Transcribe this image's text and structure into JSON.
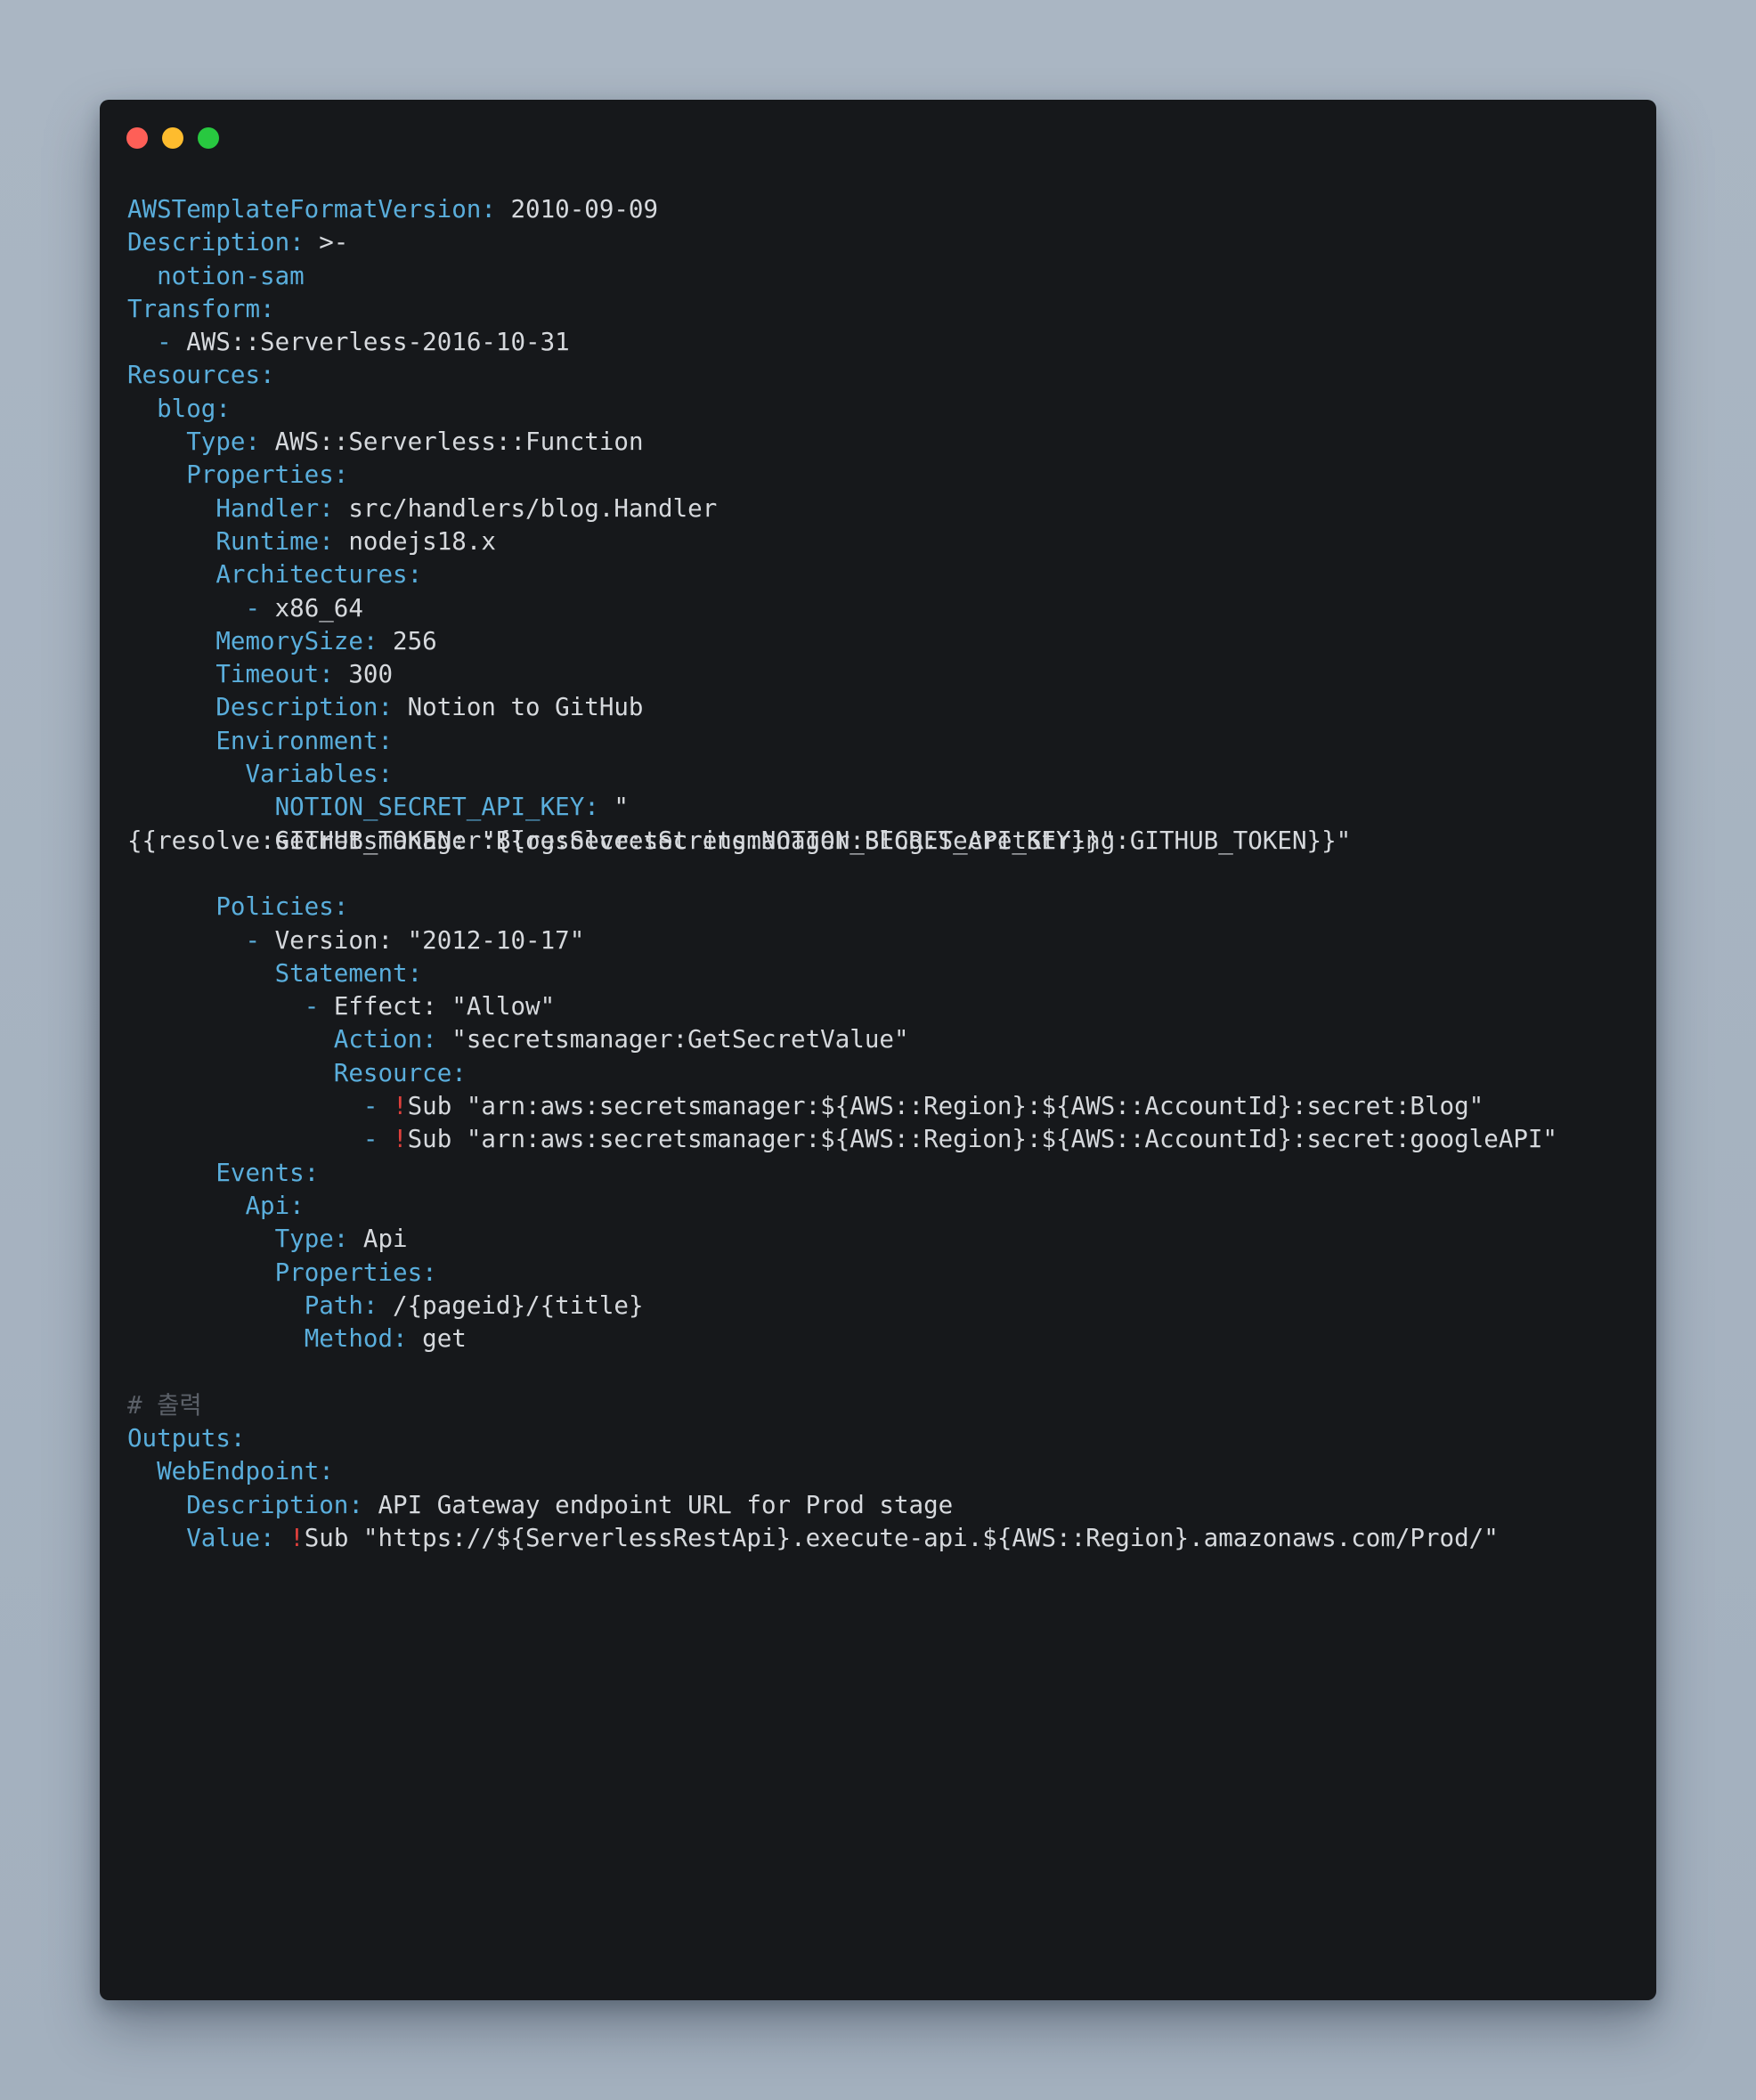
{
  "window": {
    "buttons": {
      "close_color": "#fe5f57",
      "minimize_color": "#febc2e",
      "maximize_color": "#28c840"
    }
  },
  "code": {
    "language": "yaml",
    "colors": {
      "key": "#5aaedc",
      "value": "#d6d9dd",
      "tag": "#e0403c",
      "comment": "#5b6068",
      "background": "#16181b"
    },
    "lines": [
      {
        "indent": "",
        "key": "AWSTemplateFormatVersion:",
        "value": " 2010-09-09"
      },
      {
        "indent": "",
        "key": "Description:",
        "value": " >-"
      },
      {
        "indent": "  ",
        "key": "",
        "key_value": "notion-sam"
      },
      {
        "indent": "",
        "key": "Transform:"
      },
      {
        "indent": "  ",
        "dash": "- ",
        "value": "AWS::Serverless-2016-10-31"
      },
      {
        "indent": "",
        "key": "Resources:"
      },
      {
        "indent": "  ",
        "key": "blog:"
      },
      {
        "indent": "    ",
        "key": "Type:",
        "value": " AWS::Serverless::Function"
      },
      {
        "indent": "    ",
        "key": "Properties:"
      },
      {
        "indent": "      ",
        "key": "Handler:",
        "value": " src/handlers/blog.Handler"
      },
      {
        "indent": "      ",
        "key": "Runtime:",
        "value": " nodejs18.x"
      },
      {
        "indent": "      ",
        "key": "Architectures:"
      },
      {
        "indent": "        ",
        "dash": "- ",
        "value": "x86_64"
      },
      {
        "indent": "      ",
        "key": "MemorySize:",
        "value": " 256"
      },
      {
        "indent": "      ",
        "key": "Timeout:",
        "value": " 300"
      },
      {
        "indent": "      ",
        "key": "Description:",
        "value": " Notion to GitHub"
      },
      {
        "indent": "      ",
        "key": "Environment:"
      },
      {
        "indent": "        ",
        "key": "Variables:"
      },
      {
        "indent": "          ",
        "key": "NOTION_SECRET_API_KEY:",
        "value": " \""
      },
      {
        "indent": "",
        "value": "{{resolve:secretsmanager:Blog:SecretString:NOTION_SECRET_API_KEY}}\""
      },
      {
        "indent": "",
        "value": ""
      },
      {
        "indent": "      ",
        "key": "Policies:"
      },
      {
        "indent": "        ",
        "dash": "- ",
        "value": "Version: \"2012-10-17\""
      },
      {
        "indent": "          ",
        "key": "Statement:"
      },
      {
        "indent": "            ",
        "dash": "- ",
        "value": "Effect: \"Allow\""
      },
      {
        "indent": "              ",
        "key": "Action:",
        "value": " \"secretsmanager:GetSecretValue\""
      },
      {
        "indent": "              ",
        "key": "Resource:"
      },
      {
        "indent": "                ",
        "dash": "- ",
        "tag": "!",
        "value": "Sub \"arn:aws:secretsmanager:${AWS::Region}:${AWS::AccountId}:secret:Blog\""
      },
      {
        "indent": "                ",
        "dash": "- ",
        "tag": "!",
        "value": "Sub \"arn:aws:secretsmanager:${AWS::Region}:${AWS::AccountId}:secret:googleAPI\""
      },
      {
        "indent": "      ",
        "key": "Events:"
      },
      {
        "indent": "        ",
        "key": "Api:"
      },
      {
        "indent": "          ",
        "key": "Type:",
        "value": " Api"
      },
      {
        "indent": "          ",
        "key": "Properties:"
      },
      {
        "indent": "            ",
        "key": "Path:",
        "value": " /{pageid}/{title}"
      },
      {
        "indent": "            ",
        "key": "Method:",
        "value": " get"
      },
      {
        "indent": "",
        "value": ""
      },
      {
        "indent": "",
        "comment": "# 출력"
      },
      {
        "indent": "",
        "key": "Outputs:"
      },
      {
        "indent": "  ",
        "key": "WebEndpoint:"
      },
      {
        "indent": "    ",
        "key": "Description:",
        "value": " API Gateway endpoint URL for Prod stage"
      },
      {
        "indent": "    ",
        "key": "Value:",
        "value_pre": " ",
        "tag": "!",
        "value": "Sub \"https://${ServerlessRestApi}.execute-api.${AWS::Region}.amazonaws.com/Prod/\""
      }
    ],
    "overlay_line": {
      "row": 19,
      "indent": "          ",
      "text": "GITHUB_TOKEN: \"{{resolve:secretsmanager:Blog:SecretString:GITHUB_TOKEN}}\""
    }
  }
}
